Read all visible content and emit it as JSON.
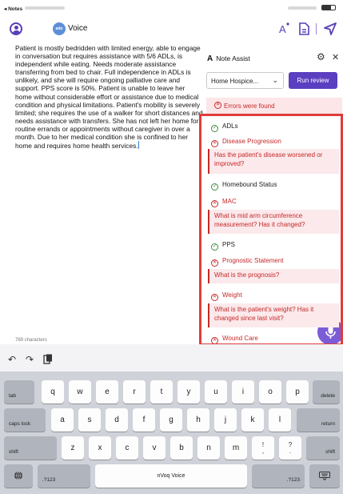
{
  "status_bar": {
    "back": "◂ Notes"
  },
  "toolbar": {
    "voice_logo": "ado",
    "title": "Voice"
  },
  "note": {
    "text": "Patient is mostly bedridden with limited energy, able to engage in conversation but requires assistance with 5/6 ADLs, is independent while eating. Needs moderate assistance transferring from bed to chair. Full independence in ADLs is unlikely, and she will require ongoing palliative care and support. PPS score is 50%. Patient is unable to leave her home without considerable effort or assistance due to medical condition and physical limitations. Patient's mobility is severely limited; she requires the use of a walker for short distances and needs assistance with transfers. She has not left her home for routine errands or appointments without caregiver in over a month. Due to her medical condition she is confined to her home and requires home health services.",
    "char_count": "769 characters"
  },
  "panel": {
    "title_icon": "A",
    "title": "Note Assist",
    "select_value": "Home Hospice...",
    "run_label": "Run review",
    "errors_label": "Errors were found",
    "checks": [
      {
        "label": "ADLs",
        "status": "ok"
      },
      {
        "label": "Disease Progression",
        "status": "error",
        "question": "Has the patient's disease worsened or improved?"
      },
      {
        "label": "Homebound Status",
        "status": "ok"
      },
      {
        "label": "MAC",
        "status": "error",
        "question": "What is mid arm circumference measurement? Has it changed?"
      },
      {
        "label": "PPS",
        "status": "ok"
      },
      {
        "label": "Prognostic Statement",
        "status": "error",
        "question": "What is the prognosis?"
      },
      {
        "label": "Weight",
        "status": "error",
        "question": "What is the patient's weight? Has it changed since last visit?"
      },
      {
        "label": "Wound Care",
        "status": "error"
      }
    ]
  },
  "keyboard": {
    "row1": [
      "q",
      "w",
      "e",
      "r",
      "t",
      "y",
      "u",
      "i",
      "o",
      "p"
    ],
    "row2": [
      "a",
      "s",
      "d",
      "f",
      "g",
      "h",
      "j",
      "k",
      "l"
    ],
    "row3": [
      "z",
      "x",
      "c",
      "v",
      "b",
      "n",
      "m"
    ],
    "tab": "tab",
    "delete": "delete",
    "caps": "caps lock",
    "return": "return",
    "shift": "shift",
    "num": ".?123",
    "space": "nVoq Voice",
    "excl": [
      "!",
      ","
    ],
    "quest": [
      "?",
      "."
    ]
  },
  "colors": {
    "accent": "#5b3fc0",
    "error": "#c62828",
    "ok": "#3d8b40",
    "highlight": "#e03c3c"
  }
}
